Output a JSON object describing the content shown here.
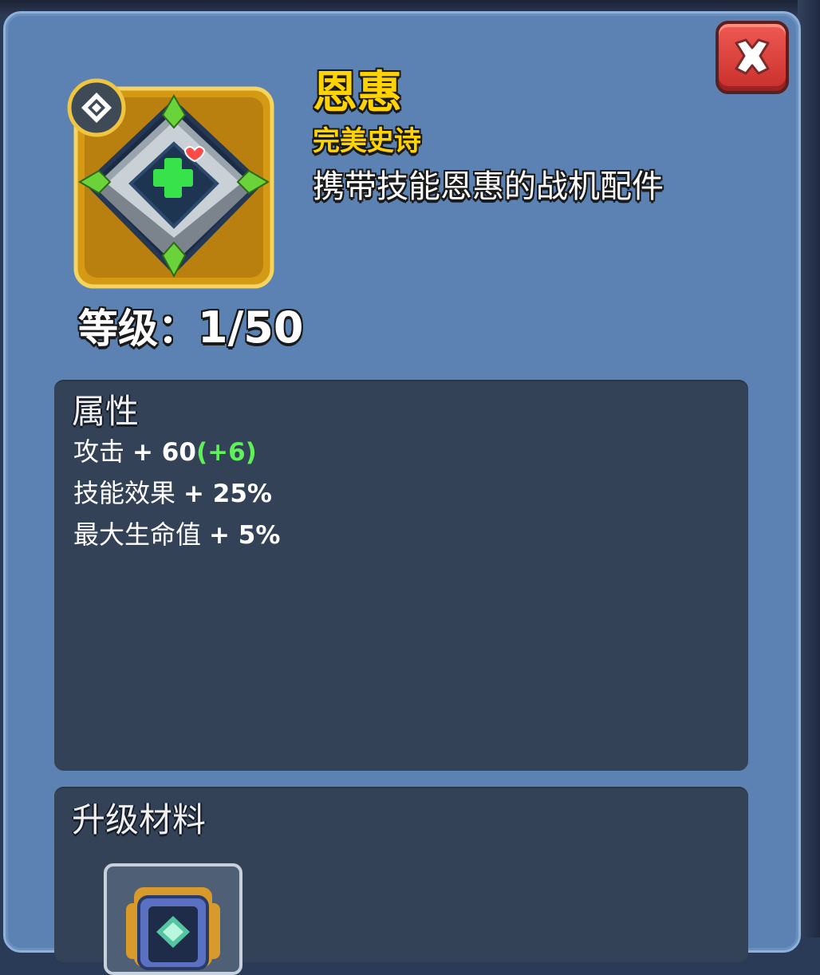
{
  "item": {
    "name": "恩惠",
    "rarity": "完美史诗",
    "description": "携带技能恩惠的战机配件",
    "icon": "square-frame-heal-icon",
    "rarity_badge_icon": "diamond-rarity-icon"
  },
  "level": {
    "label": "等级：",
    "value": "1/50"
  },
  "attributes": {
    "title": "属性",
    "rows": [
      {
        "name": "攻击",
        "value": "+ 60",
        "bonus": "(+6)"
      },
      {
        "name": "技能效果",
        "value": "+ 25%",
        "bonus": ""
      },
      {
        "name": "最大生命值",
        "value": "+ 5%",
        "bonus": ""
      }
    ]
  },
  "materials": {
    "title": "升级材料",
    "items": [
      {
        "icon": "upgrade-chip-icon"
      }
    ]
  },
  "colors": {
    "panel": "#5b82b3",
    "box": "#344257",
    "name_gold": "#ffd400",
    "bonus_green": "#5ff05a",
    "close_red": "#e04540"
  }
}
